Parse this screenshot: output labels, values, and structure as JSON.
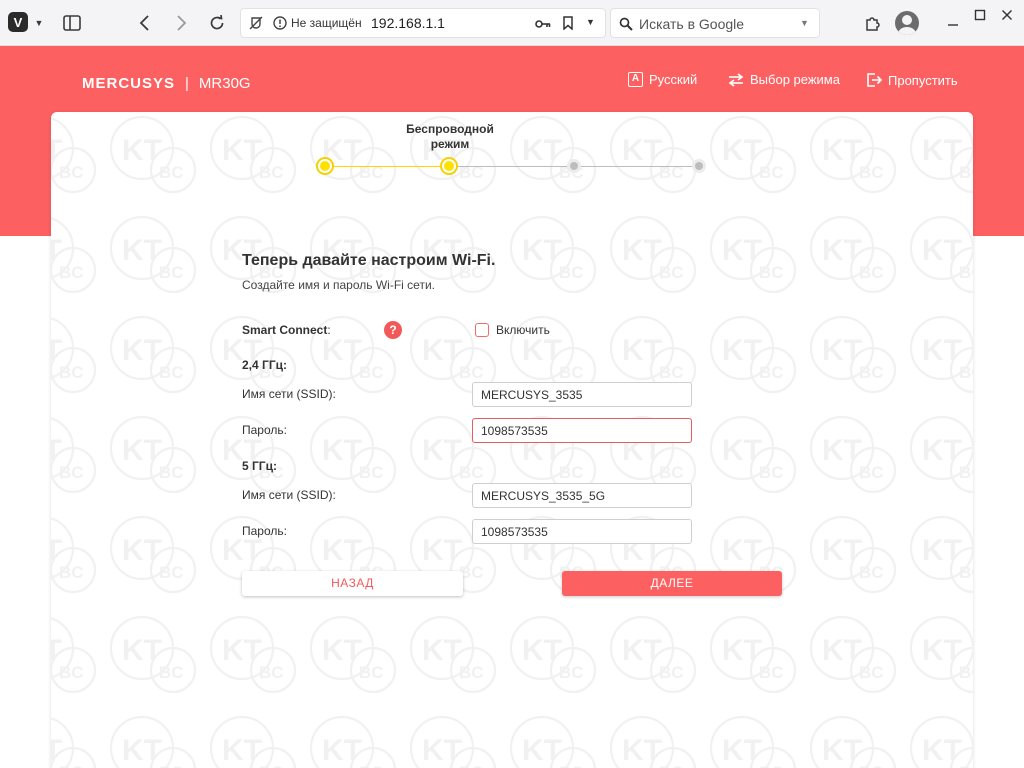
{
  "browser": {
    "security_label": "Не защищён",
    "url": "192.168.1.1",
    "search_placeholder": "Искать в Google"
  },
  "header": {
    "brand": "MERCUSYS",
    "separator": "|",
    "model": "MR30G",
    "nav": [
      {
        "label": "Русский",
        "icon": "language-icon"
      },
      {
        "label": "Выбор режима",
        "icon": "mode-switch-icon"
      },
      {
        "label": "Пропустить",
        "icon": "skip-icon"
      }
    ]
  },
  "stepper": {
    "current_label": "Беспроводной режим",
    "steps_total": 4,
    "current_step": 2,
    "active_color": "#ffe100"
  },
  "form": {
    "title": "Теперь давайте настроим Wi-Fi.",
    "subtitle": "Создайте имя и пароль Wi-Fi сети.",
    "smart_connect_label": "Smart Connect",
    "smart_connect_colon": ":",
    "smart_connect_help": "?",
    "smart_connect_checkbox_label": "Включить",
    "smart_connect_checked": false,
    "band_24": {
      "heading": "2,4 ГГц:",
      "ssid_label": "Имя сети (SSID):",
      "ssid_value": "MERCUSYS_3535",
      "password_label": "Пароль:",
      "password_value": "1098573535"
    },
    "band_5": {
      "heading": "5 ГГц:",
      "ssid_label": "Имя сети (SSID):",
      "ssid_value": "MERCUSYS_3535_5G",
      "password_label": "Пароль:",
      "password_value": "1098573535"
    },
    "back_label": "НАЗАД",
    "next_label": "ДАЛЕЕ"
  },
  "colors": {
    "brand_red": "#fc6061",
    "chrome_bg": "#f4f4f6"
  }
}
